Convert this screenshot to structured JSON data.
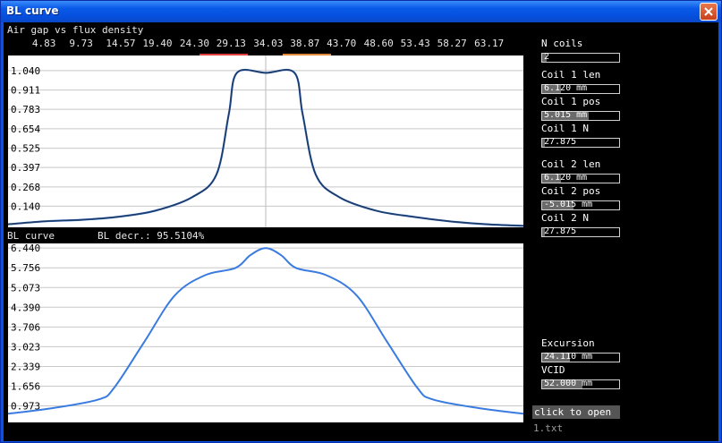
{
  "window": {
    "title": "BL curve"
  },
  "top_chart": {
    "title": "Air gap vs flux density",
    "x_ticks": [
      "4.83",
      "9.73",
      "14.57",
      "19.40",
      "24.30",
      "29.13",
      "34.03",
      "38.87",
      "43.70",
      "48.60",
      "53.43",
      "58.27",
      "63.17"
    ],
    "y_ticks": [
      "1.040",
      "0.911",
      "0.783",
      "0.654",
      "0.525",
      "0.397",
      "0.268",
      "0.140"
    ]
  },
  "bottom_chart": {
    "title": "BL curve",
    "bl_decr_text": "BL decr.: 95.5104%",
    "y_ticks": [
      "6.440",
      "5.756",
      "5.073",
      "4.390",
      "3.706",
      "3.023",
      "2.339",
      "1.656",
      "0.973"
    ]
  },
  "controls": {
    "n_coils": {
      "label": "N coils",
      "value": "2",
      "fill": 0.06
    },
    "coil1_len": {
      "label": "Coil 1 len",
      "value": "6.120 mm",
      "fill": 0.24
    },
    "coil1_pos": {
      "label": "Coil 1 pos",
      "value": "5.015 mm",
      "fill": 0.6
    },
    "coil1_n": {
      "label": "Coil 1 N",
      "value": "27.875",
      "fill": 0.04
    },
    "coil2_len": {
      "label": "Coil 2 len",
      "value": "6.120 mm",
      "fill": 0.24
    },
    "coil2_pos": {
      "label": "Coil 2 pos",
      "value": "-5.015 mm",
      "fill": 0.41
    },
    "coil2_n": {
      "label": "Coil 2 N",
      "value": "27.875",
      "fill": 0.04
    },
    "excursion": {
      "label": "Excursion",
      "value": "24.110 mm",
      "fill": 0.36
    },
    "vcid": {
      "label": "VCID",
      "value": "52.000 mm",
      "fill": 0.52
    }
  },
  "open_button": {
    "label": "click to open"
  },
  "file": {
    "name": "1.txt"
  },
  "colors": {
    "curve_blue": "#3a7be0",
    "curve_dark": "#1f3a63",
    "coil1_marker": "#e04040",
    "coil2_marker": "#e08a3a"
  },
  "chart_data": [
    {
      "type": "line",
      "title": "Air gap vs flux density",
      "x": [
        0,
        4.83,
        9.73,
        14.57,
        19.4,
        24.3,
        27.5,
        29.13,
        30.2,
        34.03,
        37.8,
        38.87,
        40.6,
        43.7,
        48.6,
        53.43,
        58.27,
        63.17,
        68
      ],
      "series": [
        {
          "values": [
            0.02,
            0.04,
            0.05,
            0.07,
            0.11,
            0.2,
            0.35,
            0.75,
            1.025,
            1.025,
            1.025,
            0.75,
            0.35,
            0.2,
            0.11,
            0.07,
            0.04,
            0.02,
            0.01
          ]
        }
      ],
      "coil_markers": [
        {
          "x": [
            25.3,
            31.6
          ]
        },
        {
          "x": [
            36.2,
            42.6
          ]
        }
      ],
      "x_ticks": [
        "4.83",
        "9.73",
        "14.57",
        "19.40",
        "24.30",
        "29.13",
        "34.03",
        "38.87",
        "43.70",
        "48.60",
        "53.43",
        "58.27",
        "63.17"
      ],
      "y_ticks": [
        "1.040",
        "0.911",
        "0.783",
        "0.654",
        "0.525",
        "0.397",
        "0.268",
        "0.140"
      ],
      "ylim": [
        0.0,
        1.14
      ],
      "grid": true
    },
    {
      "type": "line",
      "title": "BL curve",
      "x": [
        0,
        6,
        12,
        14,
        18,
        22,
        26,
        30,
        32,
        34,
        36,
        38,
        42,
        46,
        50,
        54,
        56,
        62,
        68
      ],
      "series": [
        {
          "values": [
            0.7,
            0.9,
            1.2,
            1.6,
            3.2,
            4.8,
            5.5,
            5.75,
            6.2,
            6.44,
            6.2,
            5.75,
            5.5,
            4.8,
            3.2,
            1.6,
            1.2,
            0.9,
            0.7
          ]
        }
      ],
      "y_ticks": [
        "6.440",
        "5.756",
        "5.073",
        "4.390",
        "3.706",
        "3.023",
        "2.339",
        "1.656",
        "0.973"
      ],
      "ylim": [
        0.4,
        6.6
      ],
      "grid": true
    }
  ]
}
